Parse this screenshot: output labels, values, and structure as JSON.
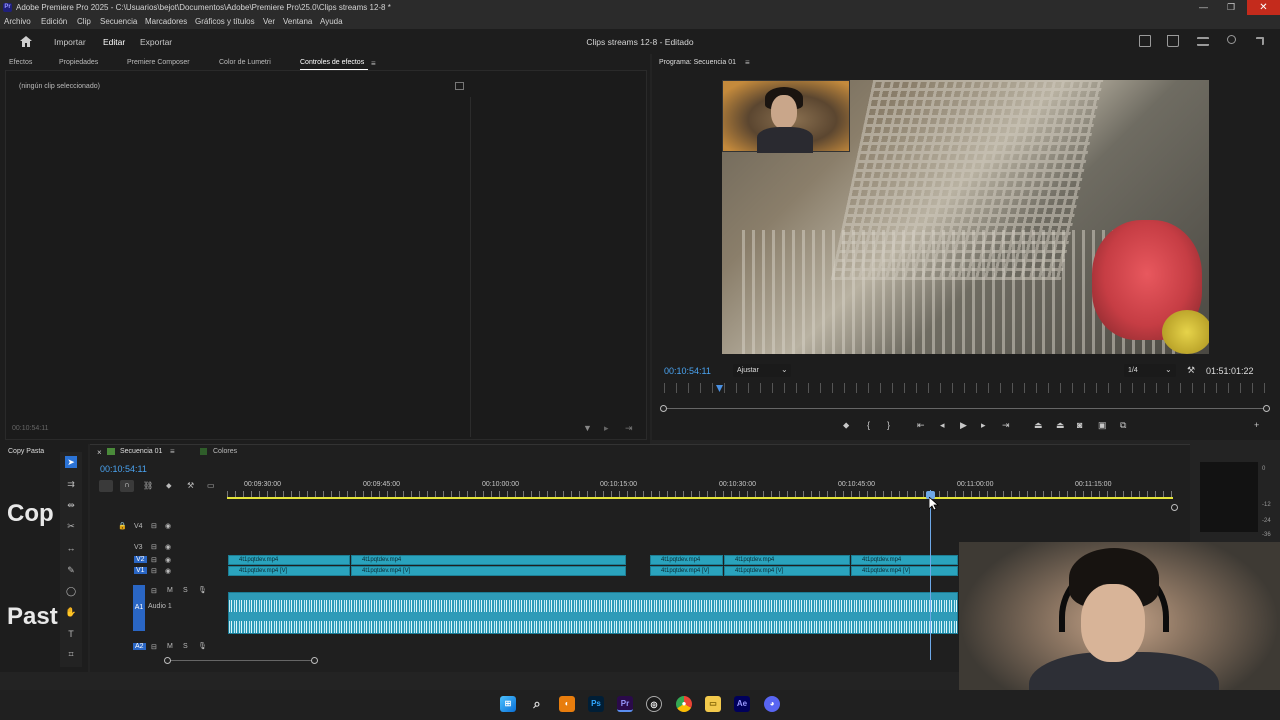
{
  "window": {
    "title": "Adobe Premiere Pro 2025 - C:\\Usuarios\\bejot\\Documentos\\Adobe\\Premiere Pro\\25.0\\Clips streams 12-8 *",
    "logo": "Pr",
    "close": "✕",
    "max": "❐",
    "min": "—"
  },
  "menu": [
    "Archivo",
    "Edición",
    "Clip",
    "Secuencia",
    "Marcadores",
    "Gráficos y títulos",
    "Ver",
    "Ventana",
    "Ayuda"
  ],
  "header": {
    "import": "Importar",
    "edit": "Editar",
    "export": "Exportar",
    "doc_title": "Clips streams 12-8 - Editado"
  },
  "left_tabs": [
    "Efectos",
    "Propiedades",
    "Premiere Composer",
    "Color de Lumetri",
    "Controles de efectos"
  ],
  "effect_controls": {
    "empty": "(ningún clip seleccionado)",
    "timecode": "00:10:54:11"
  },
  "program": {
    "tab": "Programa: Secuencia 01",
    "timecode": "00:10:54:11",
    "fit": "Ajustar",
    "quality": "1/4",
    "duration": "01:51:01:22"
  },
  "project": {
    "tab": "Copy Pasta",
    "big1": "Cop",
    "big2": "Past"
  },
  "timeline": {
    "seq_tab": "Secuencia 01",
    "colors_tab": "Colores",
    "timecode": "00:10:54:11",
    "ruler": [
      "00:09:30:00",
      "00:09:45:00",
      "00:10:00:00",
      "00:10:15:00",
      "00:10:30:00",
      "00:10:45:00",
      "00:11:00:00",
      "00:11:15:00"
    ],
    "tracks": {
      "v4": "V4",
      "v3": "V3",
      "v2": "V2",
      "v1": "V1",
      "a1": "A1",
      "a1_name": "Audio 1",
      "a2": "A2",
      "m": "M",
      "s": "S"
    },
    "clip_name": "4t1pqtdev.mp4",
    "clip_name_v": "4t1pqtdev.mp4 [V]"
  },
  "meter_labels": [
    "0",
    "-12",
    "-24",
    "-36"
  ],
  "taskbar_icons": [
    "windows-icon",
    "search-icon",
    "blender-icon",
    "photoshop-icon",
    "premiere-icon",
    "obs-icon",
    "chrome-icon",
    "folder-icon",
    "aftereffects-icon",
    "discord-icon"
  ]
}
